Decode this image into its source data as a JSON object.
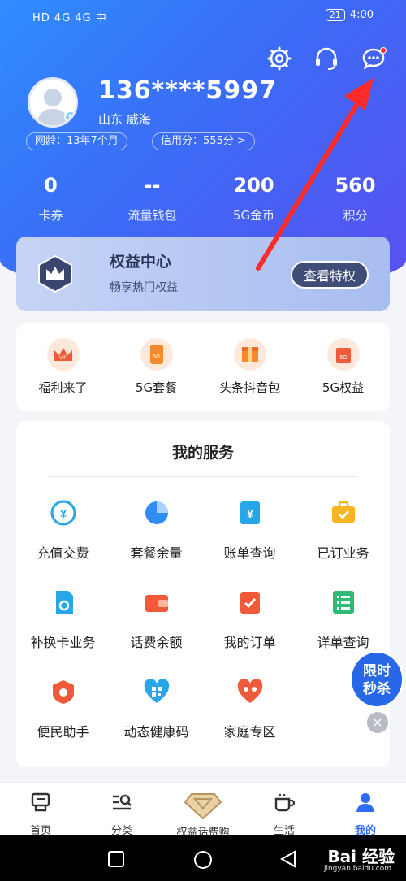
{
  "status": {
    "left": "HD 4G 4G 中",
    "battery": "21",
    "time": "4:00"
  },
  "user": {
    "phone": "136****5997",
    "region": "山东  威海",
    "network_age": "网龄：13年7个月",
    "credit": "信用分：555分 >"
  },
  "stats": [
    {
      "value": "0",
      "label": "卡券"
    },
    {
      "value": "--",
      "label": "流量钱包"
    },
    {
      "value": "200",
      "label": "5G金币"
    },
    {
      "value": "560",
      "label": "积分"
    }
  ],
  "benefit": {
    "title": "权益中心",
    "subtitle": "畅享热门权益",
    "button": "查看特权"
  },
  "quick": [
    {
      "label": "福利来了"
    },
    {
      "label": "5G套餐"
    },
    {
      "label": "头条抖音包"
    },
    {
      "label": "5G权益"
    }
  ],
  "services": {
    "title": "我的服务",
    "items": [
      {
        "label": "充值交费"
      },
      {
        "label": "套餐余量"
      },
      {
        "label": "账单查询"
      },
      {
        "label": "已订业务"
      },
      {
        "label": "补换卡业务"
      },
      {
        "label": "话费余额"
      },
      {
        "label": "我的订单"
      },
      {
        "label": "详单查询"
      },
      {
        "label": "便民助手"
      },
      {
        "label": "动态健康码"
      },
      {
        "label": "家庭专区"
      }
    ]
  },
  "flash_sale": {
    "line1": "限时",
    "line2": "秒杀",
    "close": "×"
  },
  "tabs": [
    {
      "label": "首页"
    },
    {
      "label": "分类"
    },
    {
      "label": "权益话费购"
    },
    {
      "label": "生活"
    },
    {
      "label": "我的"
    }
  ],
  "watermark": {
    "text": "Bai 经验",
    "sub": "jingyan.baidu.com"
  },
  "colors": {
    "primary": "#2f6cf6",
    "header_start": "#2f8cff",
    "header_end": "#5a4ff0",
    "accent_red": "#ff2f3c"
  }
}
